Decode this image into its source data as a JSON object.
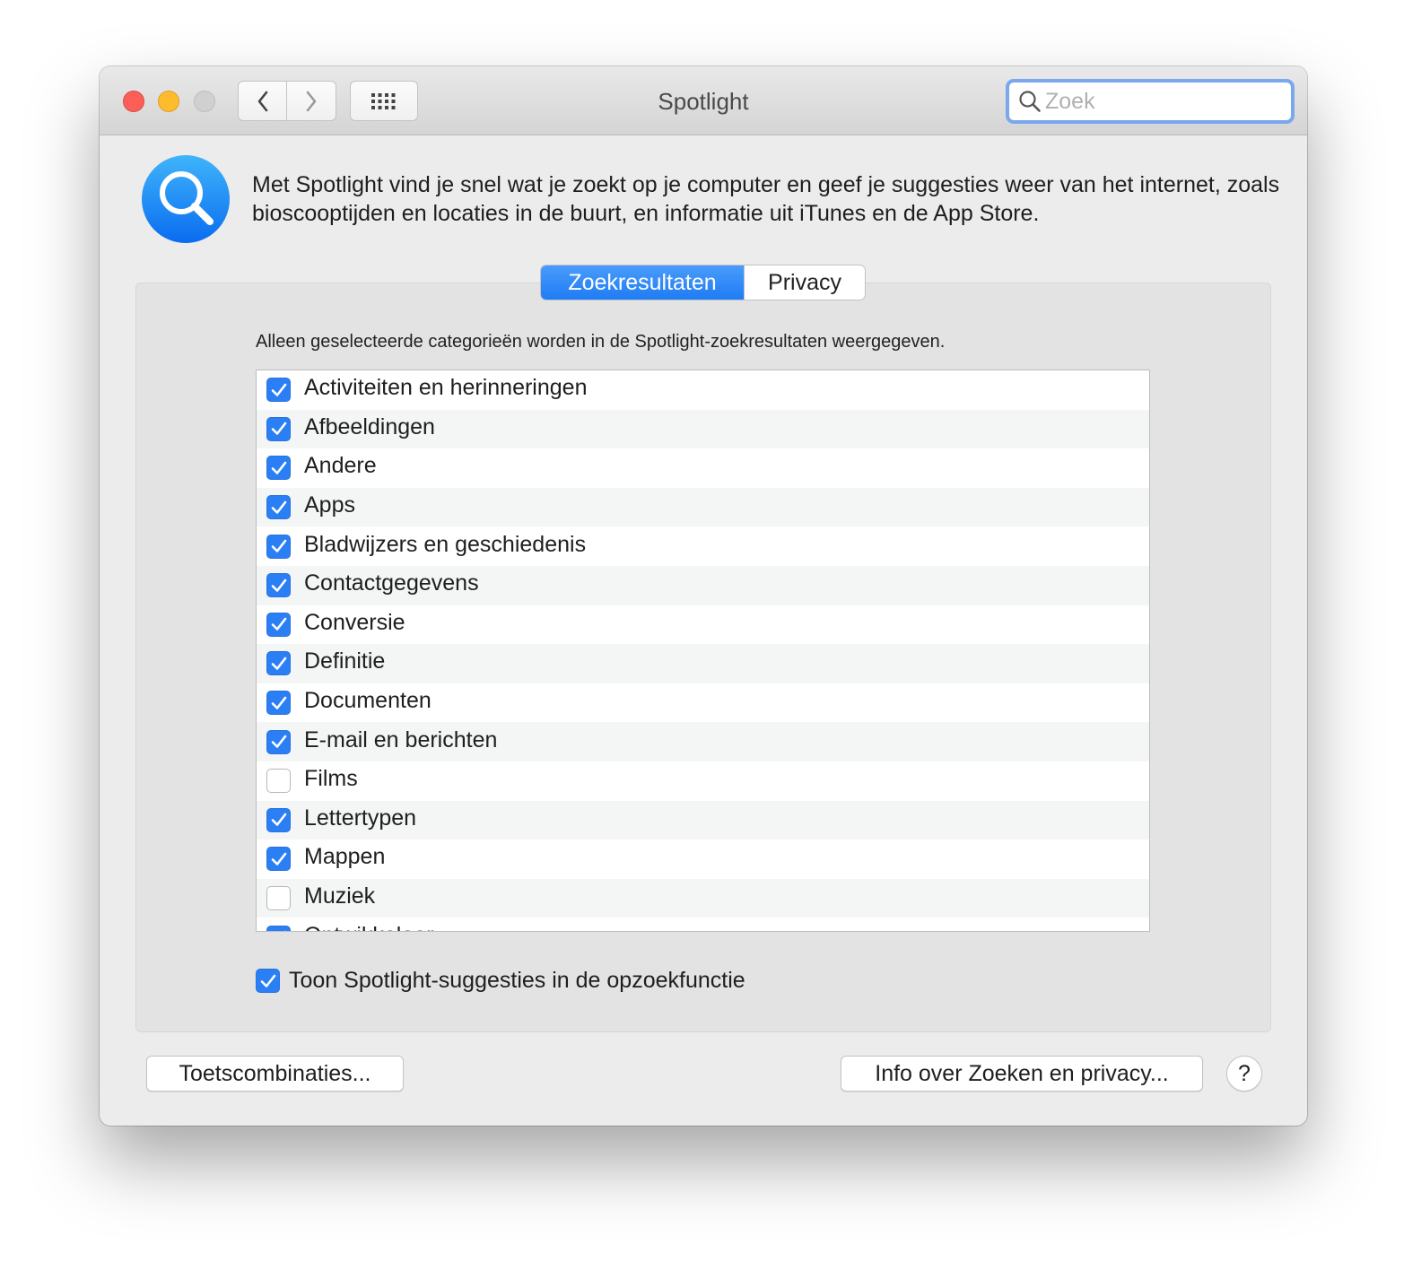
{
  "window": {
    "title": "Spotlight",
    "search_placeholder": "Zoek"
  },
  "header": {
    "icon": "spotlight-magnifier-icon",
    "description": "Met Spotlight vind je snel wat je zoekt op je computer en geef je suggesties weer van het internet, zoals bioscooptijden en locaties in de buurt, en informatie uit iTunes en de App Store."
  },
  "tabs": [
    {
      "label": "Zoekresultaten",
      "active": true
    },
    {
      "label": "Privacy",
      "active": false
    }
  ],
  "results": {
    "caption": "Alleen geselecteerde categorieën worden in de Spotlight-zoekresultaten weergegeven.",
    "categories": [
      {
        "label": "Activiteiten en herinneringen",
        "checked": true
      },
      {
        "label": "Afbeeldingen",
        "checked": true
      },
      {
        "label": "Andere",
        "checked": true
      },
      {
        "label": "Apps",
        "checked": true
      },
      {
        "label": "Bladwijzers en geschiedenis",
        "checked": true
      },
      {
        "label": "Contactgegevens",
        "checked": true
      },
      {
        "label": "Conversie",
        "checked": true
      },
      {
        "label": "Definitie",
        "checked": true
      },
      {
        "label": "Documenten",
        "checked": true
      },
      {
        "label": "E-mail en berichten",
        "checked": true
      },
      {
        "label": "Films",
        "checked": false
      },
      {
        "label": "Lettertypen",
        "checked": true
      },
      {
        "label": "Mappen",
        "checked": true
      },
      {
        "label": "Muziek",
        "checked": false
      },
      {
        "label": "Ontwikkelaar",
        "checked": true
      }
    ],
    "lookup_suggestions": {
      "label": "Toon Spotlight-suggesties in de opzoekfunctie",
      "checked": true
    }
  },
  "footer": {
    "shortcuts_button": "Toetscombinaties...",
    "info_button": "Info over Zoeken en privacy...",
    "help_button": "?"
  },
  "colors": {
    "accent": "#2b7ff5",
    "close": "#fc5f57",
    "minimize": "#fdbc2e",
    "zoom_disabled": "#d0d0d0"
  }
}
